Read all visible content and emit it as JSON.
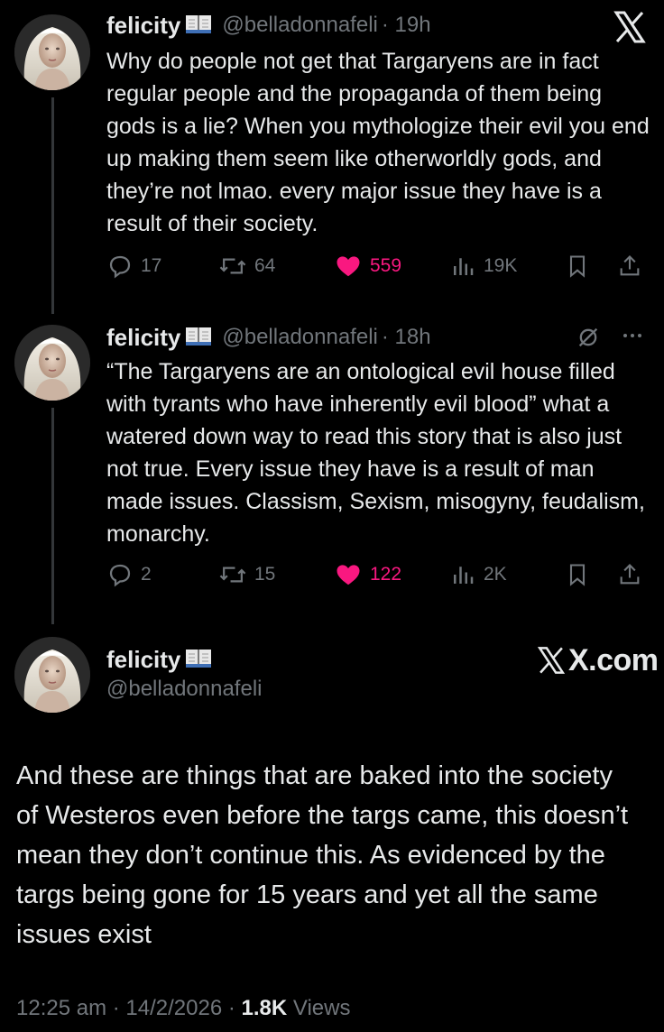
{
  "tweet1": {
    "name": "felicity",
    "handle": "@belladonnafeli",
    "time": "· 19h",
    "text": "Why do people not get that Targaryens are in fact regular people and the propaganda of them being gods is a lie? When you mythologize their evil you end up making them seem like otherworldly gods, and they’re not lmao. every major issue they have is a result of their society.",
    "replies": "17",
    "reposts": "64",
    "likes": "559",
    "views": "19K"
  },
  "tweet2": {
    "name": "felicity",
    "handle": "@belladonnafeli",
    "time": "· 18h",
    "text": "“The Targaryens are an ontological evil house filled with tyrants who have inherently evil blood” what a watered down way to read this story that is also just not true. Every issue they have is a result of man made issues. Classism, Sexism, misogyny, feudalism, monarchy.",
    "replies": "2",
    "reposts": "15",
    "likes": "122",
    "views": "2K"
  },
  "tweet3": {
    "name": "felicity",
    "handle": "@belladonnafeli",
    "brand": "X.com",
    "text": "And these are things that are baked into the society of Westeros even before the targs came, this doesn’t mean they don’t continue this. As evidenced by the targs being gone for 15 years and yet all the same issues exist",
    "timestamp": "12:25 am · 14/2/2026 · ",
    "views_count": "1.8K",
    "views_label": " Views"
  },
  "icons": {
    "reply": "reply-icon",
    "repost": "repost-icon",
    "like": "heart-icon",
    "views": "views-icon",
    "bookmark": "bookmark-icon",
    "share": "share-icon",
    "book": "open-book-emoji",
    "x_logo": "x-logo-icon",
    "grok": "grok-icon",
    "more": "more-icon"
  },
  "colors": {
    "background": "#000000",
    "text": "#e7e9ea",
    "muted": "#71767b",
    "like": "#f91880"
  }
}
